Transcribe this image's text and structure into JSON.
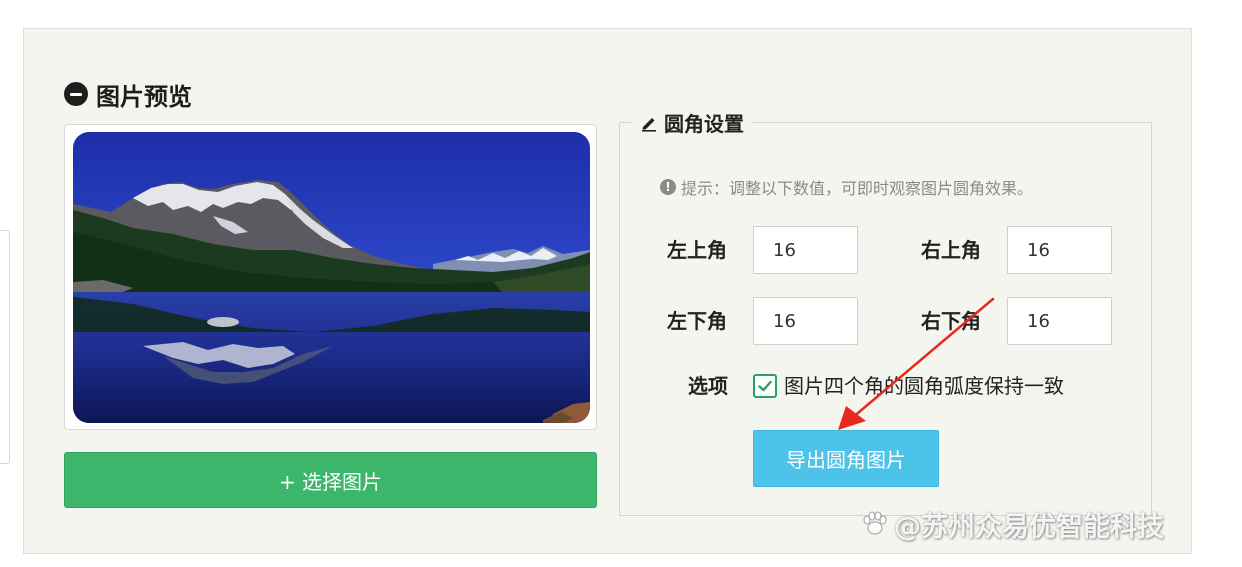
{
  "preview": {
    "title": "图片预览",
    "choose_button": "+ 选择图片"
  },
  "settings": {
    "legend": "圆角设置",
    "hint": "提示：调整以下数值，可即时观察图片圆角效果。",
    "top_left_label": "左上角",
    "top_left_value": "16",
    "top_right_label": "右上角",
    "top_right_value": "16",
    "bottom_left_label": "左下角",
    "bottom_left_value": "16",
    "bottom_right_label": "右下角",
    "bottom_right_value": "16",
    "options_label": "选项",
    "checkbox_label": "图片四个角的圆角弧度保持一致",
    "checkbox_checked": true,
    "export_button": "导出圆角图片"
  },
  "watermark": "@苏州众易优智能科技",
  "icons": {
    "title_icon": "minus-circle-icon",
    "legend_icon": "pencil-icon",
    "hint_icon": "info-icon",
    "checkbox_icon": "check-icon",
    "watermark_icon": "paw-icon"
  },
  "colors": {
    "choose_button": "#3bb66b",
    "export_button": "#4ec3e9",
    "checkbox": "#27a06f",
    "arrow": "#e8281c",
    "panel": "#f5f5f0"
  }
}
